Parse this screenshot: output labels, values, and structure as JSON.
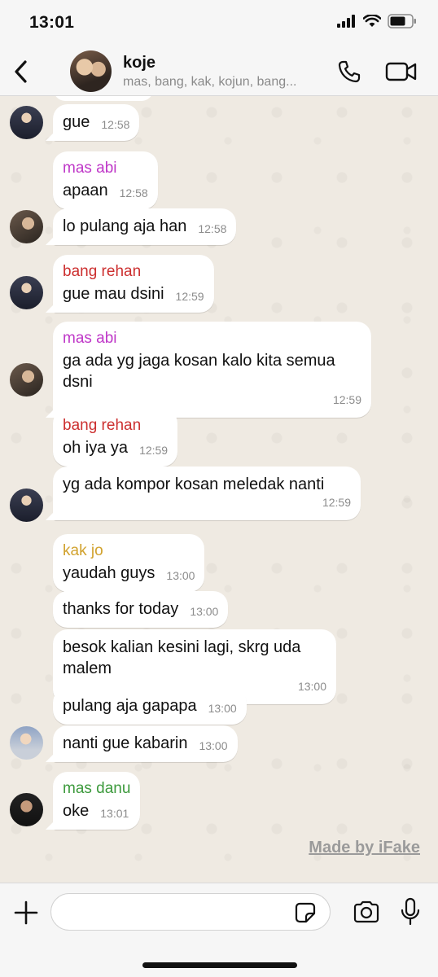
{
  "status_bar": {
    "time": "13:01"
  },
  "header": {
    "group_name": "koje",
    "members": "mas, bang, kak, kojun, bang..."
  },
  "messages": [
    {
      "text": "gue",
      "time": "12:58"
    },
    {
      "sender": "mas abi",
      "text": "apaan",
      "time": "12:58"
    },
    {
      "text": "lo pulang aja han",
      "time": "12:58"
    },
    {
      "sender": "bang rehan",
      "text": "gue mau dsini",
      "time": "12:59"
    },
    {
      "sender": "mas abi",
      "text": "ga ada yg jaga kosan kalo kita semua dsni",
      "time": "12:59"
    },
    {
      "sender": "bang rehan",
      "text": "oh iya ya",
      "time": "12:59"
    },
    {
      "text": "yg ada kompor kosan meledak nanti",
      "time": "12:59"
    },
    {
      "sender": "kak jo",
      "text": "yaudah guys",
      "time": "13:00"
    },
    {
      "text": "thanks for today",
      "time": "13:00"
    },
    {
      "text": "besok kalian kesini lagi, skrg uda malem",
      "time": "13:00"
    },
    {
      "text": "pulang aja gapapa",
      "time": "13:00"
    },
    {
      "text": "nanti gue kabarin",
      "time": "13:00"
    },
    {
      "sender": "mas danu",
      "text": "oke",
      "time": "13:01"
    }
  ],
  "watermark": "Made by iFake",
  "input": {
    "placeholder": ""
  },
  "colors": {
    "mas_abi": "#bf38c8",
    "bang_rehan": "#cc2f2f",
    "kak_jo": "#d1a22e",
    "mas_danu": "#3d9a3d",
    "chat_background": "#efeae2"
  },
  "icons": [
    "back-chevron-icon",
    "phone-icon",
    "video-camera-icon",
    "plus-icon",
    "sticker-icon",
    "camera-icon",
    "microphone-icon"
  ]
}
